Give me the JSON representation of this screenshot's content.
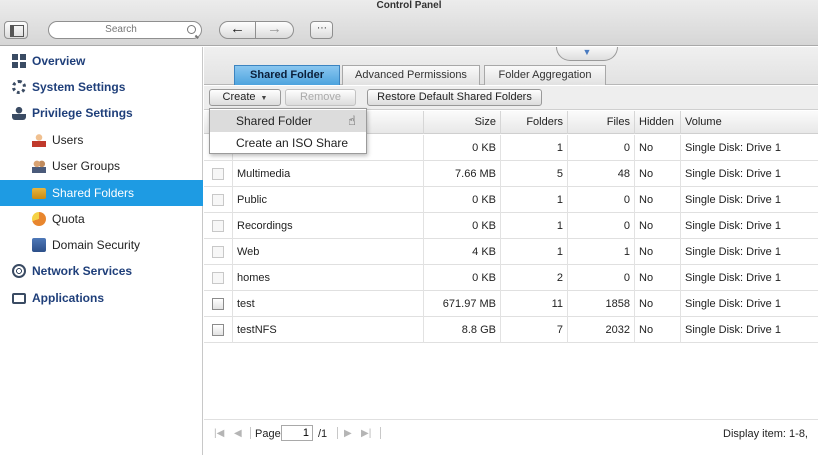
{
  "app": {
    "title": "Control Panel"
  },
  "toolbar": {
    "search_placeholder": "Search",
    "back_glyph": "←",
    "forward_glyph": "→",
    "grid_glyph": "⋯"
  },
  "sidebar": {
    "items": [
      {
        "label": "Overview",
        "icon": "overview-icon",
        "kind": "category"
      },
      {
        "label": "System Settings",
        "icon": "gear-icon",
        "kind": "category"
      },
      {
        "label": "Privilege Settings",
        "icon": "person-icon",
        "kind": "category"
      },
      {
        "label": "Users",
        "icon": "user-icon",
        "kind": "sub"
      },
      {
        "label": "User Groups",
        "icon": "user-groups-icon",
        "kind": "sub"
      },
      {
        "label": "Shared Folders",
        "icon": "folder-icon",
        "kind": "sub",
        "active": true
      },
      {
        "label": "Quota",
        "icon": "quota-icon",
        "kind": "sub"
      },
      {
        "label": "Domain Security",
        "icon": "domain-icon",
        "kind": "sub"
      },
      {
        "label": "Network Services",
        "icon": "globe-icon",
        "kind": "category"
      },
      {
        "label": "Applications",
        "icon": "apps-icon",
        "kind": "category"
      }
    ]
  },
  "tabs": [
    {
      "label": "Shared Folder",
      "active": true
    },
    {
      "label": "Advanced Permissions",
      "active": false
    },
    {
      "label": "Folder Aggregation",
      "active": false
    }
  ],
  "actions": {
    "create": "Create",
    "remove": "Remove",
    "restore": "Restore Default Shared Folders"
  },
  "create_menu": {
    "items": [
      "Shared Folder",
      "Create an ISO Share"
    ]
  },
  "grid": {
    "columns": [
      "Size",
      "Folders",
      "Files",
      "Hidden",
      "Volume"
    ],
    "rows": [
      {
        "name": "",
        "size": "0 KB",
        "folders": "1",
        "files": "0",
        "hidden": "No",
        "volume": "Single Disk: Drive 1",
        "checkbox_enabled": false
      },
      {
        "name": "Multimedia",
        "size": "7.66 MB",
        "folders": "5",
        "files": "48",
        "hidden": "No",
        "volume": "Single Disk: Drive 1",
        "checkbox_enabled": false
      },
      {
        "name": "Public",
        "size": "0 KB",
        "folders": "1",
        "files": "0",
        "hidden": "No",
        "volume": "Single Disk: Drive 1",
        "checkbox_enabled": false
      },
      {
        "name": "Recordings",
        "size": "0 KB",
        "folders": "1",
        "files": "0",
        "hidden": "No",
        "volume": "Single Disk: Drive 1",
        "checkbox_enabled": false
      },
      {
        "name": "Web",
        "size": "4 KB",
        "folders": "1",
        "files": "1",
        "hidden": "No",
        "volume": "Single Disk: Drive 1",
        "checkbox_enabled": false
      },
      {
        "name": "homes",
        "size": "0 KB",
        "folders": "2",
        "files": "0",
        "hidden": "No",
        "volume": "Single Disk: Drive 1",
        "checkbox_enabled": false
      },
      {
        "name": "test",
        "size": "671.97 MB",
        "folders": "11",
        "files": "1858",
        "hidden": "No",
        "volume": "Single Disk: Drive 1",
        "checkbox_enabled": true
      },
      {
        "name": "testNFS",
        "size": "8.8 GB",
        "folders": "7",
        "files": "2032",
        "hidden": "No",
        "volume": "Single Disk: Drive 1",
        "checkbox_enabled": true
      }
    ]
  },
  "pager": {
    "page_label": "Page",
    "page_value": "1",
    "page_total": "/1",
    "display_info": "Display item: 1-8,"
  },
  "colors": {
    "accent": "#1e9be3",
    "category_text": "#1f3f7a"
  }
}
